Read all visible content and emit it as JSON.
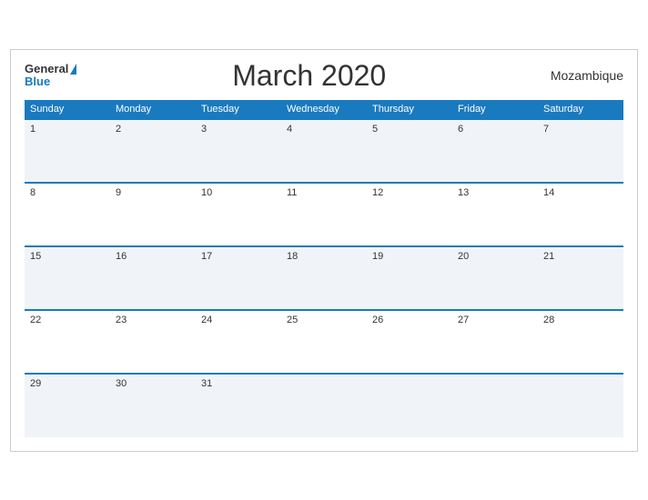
{
  "header": {
    "logo_general": "General",
    "logo_blue": "Blue",
    "title": "March 2020",
    "country": "Mozambique"
  },
  "weekdays": [
    "Sunday",
    "Monday",
    "Tuesday",
    "Wednesday",
    "Thursday",
    "Friday",
    "Saturday"
  ],
  "weeks": [
    [
      1,
      2,
      3,
      4,
      5,
      6,
      7
    ],
    [
      8,
      9,
      10,
      11,
      12,
      13,
      14
    ],
    [
      15,
      16,
      17,
      18,
      19,
      20,
      21
    ],
    [
      22,
      23,
      24,
      25,
      26,
      27,
      28
    ],
    [
      29,
      30,
      31,
      null,
      null,
      null,
      null
    ]
  ]
}
